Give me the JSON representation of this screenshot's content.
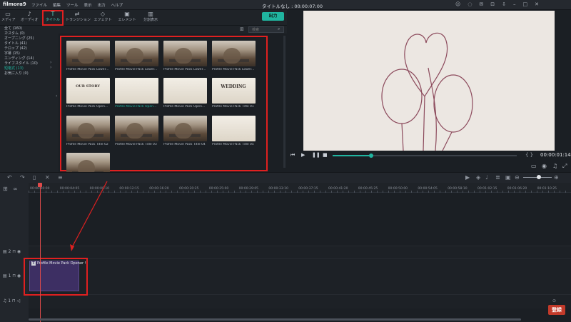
{
  "app": {
    "logo": "filmora9",
    "window_title": "タイトルなし : 00:00:07:00",
    "menu": [
      "ファイル",
      "編集",
      "ツール",
      "表示",
      "出力",
      "ヘルプ"
    ]
  },
  "toolbar": {
    "tabs": [
      {
        "label": "メディア",
        "icon": "folder-icon"
      },
      {
        "label": "オーディオ",
        "icon": "music-note-icon"
      },
      {
        "label": "タイトル",
        "icon": "title-icon"
      },
      {
        "label": "トランジション",
        "icon": "transition-icon"
      },
      {
        "label": "エフェクト",
        "icon": "effects-icon"
      },
      {
        "label": "エレメント",
        "icon": "element-icon"
      },
      {
        "label": "分割表示",
        "icon": "split-screen-icon"
      }
    ],
    "export_label": "出力"
  },
  "categories": [
    {
      "label": "全て (160)"
    },
    {
      "label": "カスタム (0)"
    },
    {
      "label": "オープニング (25)"
    },
    {
      "label": "タイトル (41)"
    },
    {
      "label": "テロップ (42)"
    },
    {
      "label": "字幕 (15)"
    },
    {
      "label": "エンディング (14)"
    },
    {
      "label": "ライフスタイル (10)"
    },
    {
      "label": "短格式 (13)"
    },
    {
      "label": "お気に入り (0)"
    }
  ],
  "search": {
    "placeholder": "検索"
  },
  "media_items": [
    {
      "caption": "Profile Movie Pack Lower...",
      "art": "photo",
      "text": ""
    },
    {
      "caption": "Profile Movie Pack Lower...",
      "art": "photo",
      "text": ""
    },
    {
      "caption": "Profile Movie Pack Lower...",
      "art": "photo",
      "text": ""
    },
    {
      "caption": "Profile Movie Pack Lower...",
      "art": "photo",
      "text": ""
    },
    {
      "caption": "Profile Movie Pack Open...",
      "art": "paper",
      "text": "OUR STORY"
    },
    {
      "caption": "Profile Movie Pack Open...",
      "art": "paper",
      "text": ""
    },
    {
      "caption": "Profile Movie Pack Open...",
      "art": "paper",
      "text": ""
    },
    {
      "caption": "Profile Movie Pack Title 01",
      "art": "paper",
      "text": "WEDDING"
    },
    {
      "caption": "Profile Movie Pack Title 02",
      "art": "photo",
      "text": ""
    },
    {
      "caption": "Profile Movie Pack Title 03",
      "art": "photo",
      "text": ""
    },
    {
      "caption": "Profile Movie Pack Title 04",
      "art": "photo",
      "text": ""
    },
    {
      "caption": "Profile Movie Pack Title 05",
      "art": "paper",
      "text": ""
    },
    {
      "caption": "",
      "art": "photo",
      "text": ""
    }
  ],
  "player": {
    "timecode": "00:00:01:14",
    "braces": "{  }",
    "progress": 0.21
  },
  "ruler_ticks": [
    "00:00:00:00",
    "00:00:04:05",
    "00:00:08:10",
    "00:00:12:15",
    "00:00:16:20",
    "00:00:20:25",
    "00:00:25:00",
    "00:00:29:05",
    "00:00:33:10",
    "00:00:37:15",
    "00:00:41:20",
    "00:00:45:25",
    "00:00:50:00",
    "00:00:54:05",
    "00:00:58:10",
    "00:01:02:15",
    "00:01:06:20",
    "00:01:10:25"
  ],
  "tracks": [
    {
      "label": "2"
    },
    {
      "label": "1"
    },
    {
      "label": "1"
    }
  ],
  "clip": {
    "label": "Profile Movie Pack Opener !"
  },
  "badge": "登録",
  "colors": {
    "accent": "#20b5a0",
    "highlight": "#e02020",
    "clip": "#3d2f63"
  }
}
